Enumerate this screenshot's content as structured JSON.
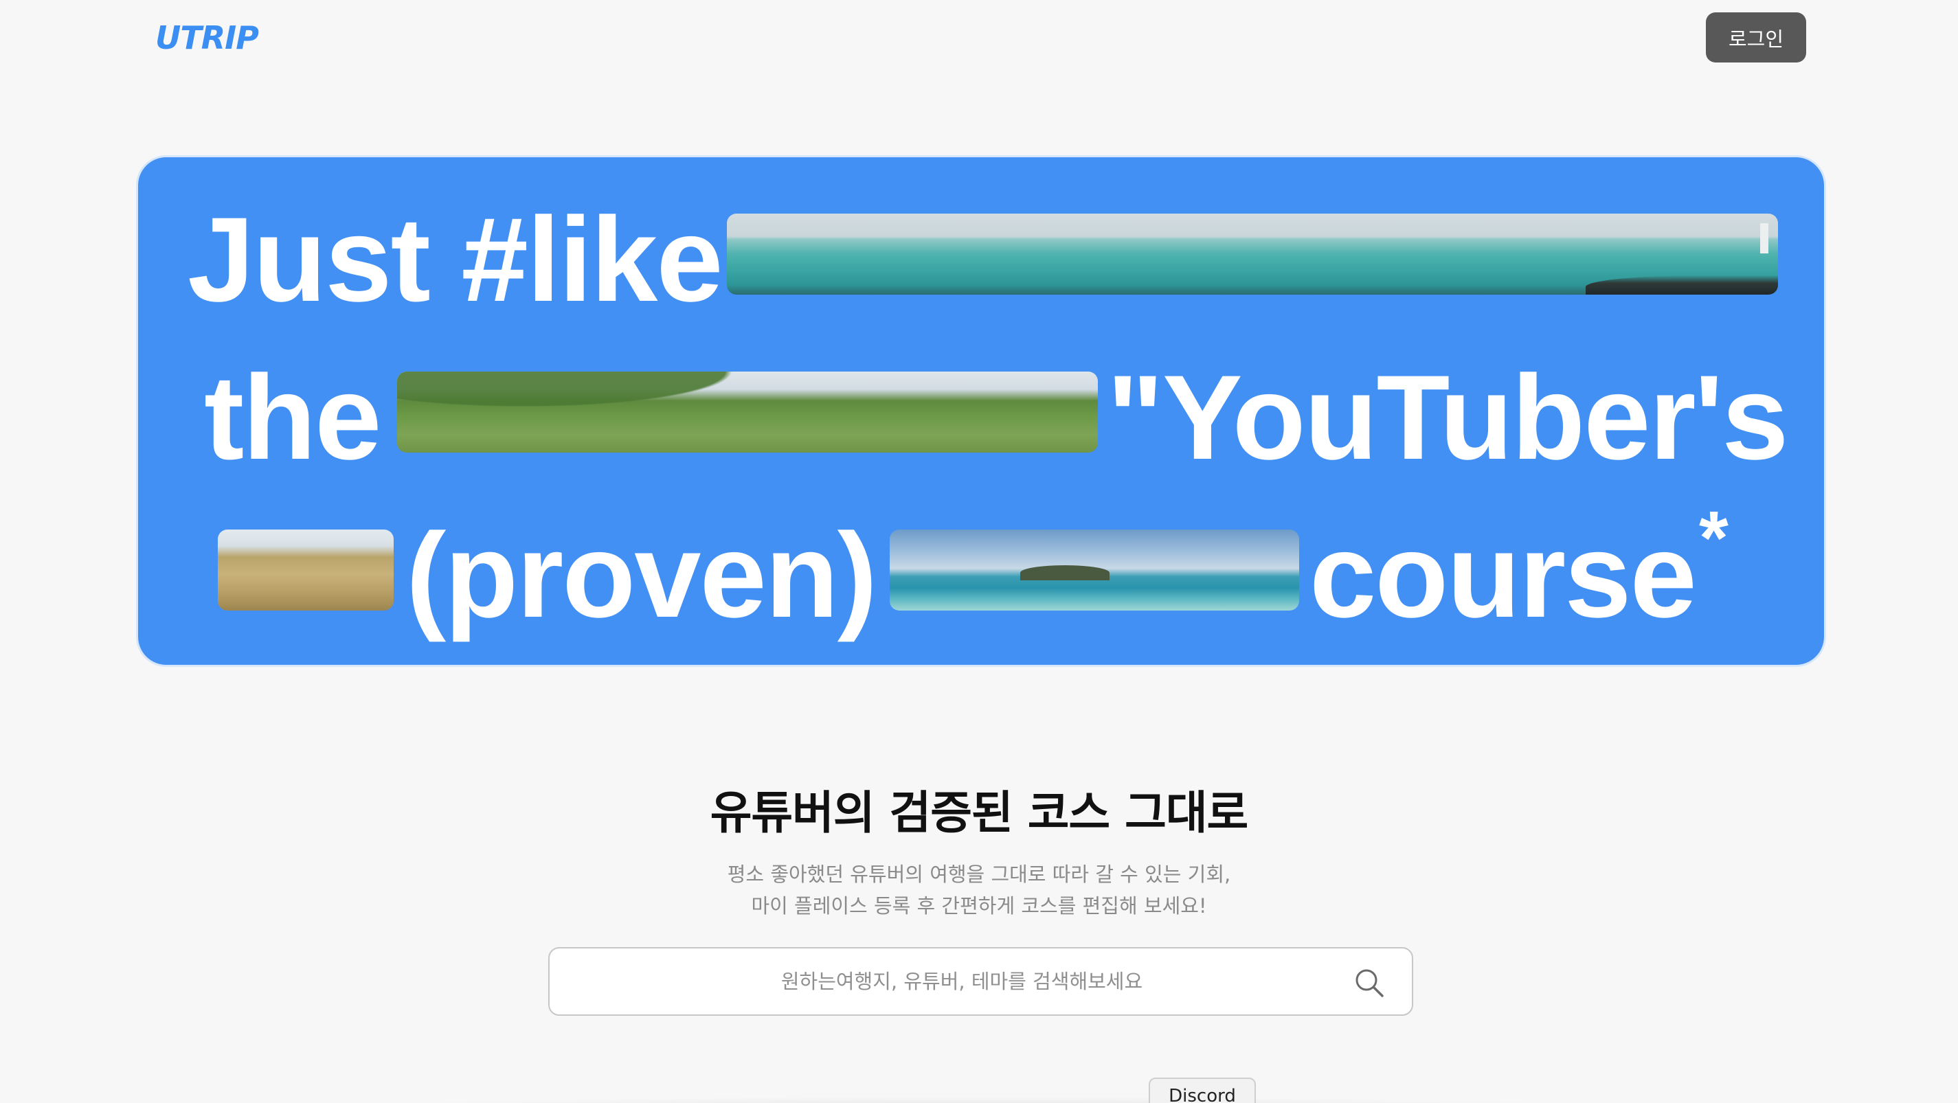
{
  "header": {
    "logo_text": "UTRIP",
    "login_label": "로그인"
  },
  "hero": {
    "line1": {
      "word1": "Just #like"
    },
    "line2": {
      "word1": "the",
      "word2": "\"YouTuber's"
    },
    "line3": {
      "word1": "(proven)",
      "word2": "course",
      "asterisk": "*"
    },
    "images": [
      "sea-photo",
      "green-hills-photo",
      "grass-oreum-photo",
      "island-sea-photo"
    ]
  },
  "intro": {
    "title": "유튜버의 검증된 코스 그대로",
    "desc_line1": "평소 좋아했던 유튜버의 여행을 그대로 따라 갈 수 있는 기회,",
    "desc_line2": "마이 플레이스 등록 후 간편하게 코스를 편집해 보세요!"
  },
  "search": {
    "placeholder": "원하는여행지, 유튜버, 테마를 검색해보세요",
    "value": "",
    "icon": "search-icon"
  },
  "footer": {
    "discord_label": "Discord"
  },
  "colors": {
    "brand": "#3b8ef2",
    "hero_bg": "#4390f5",
    "login_bg": "#585858",
    "page_bg": "#f7f7f7"
  }
}
